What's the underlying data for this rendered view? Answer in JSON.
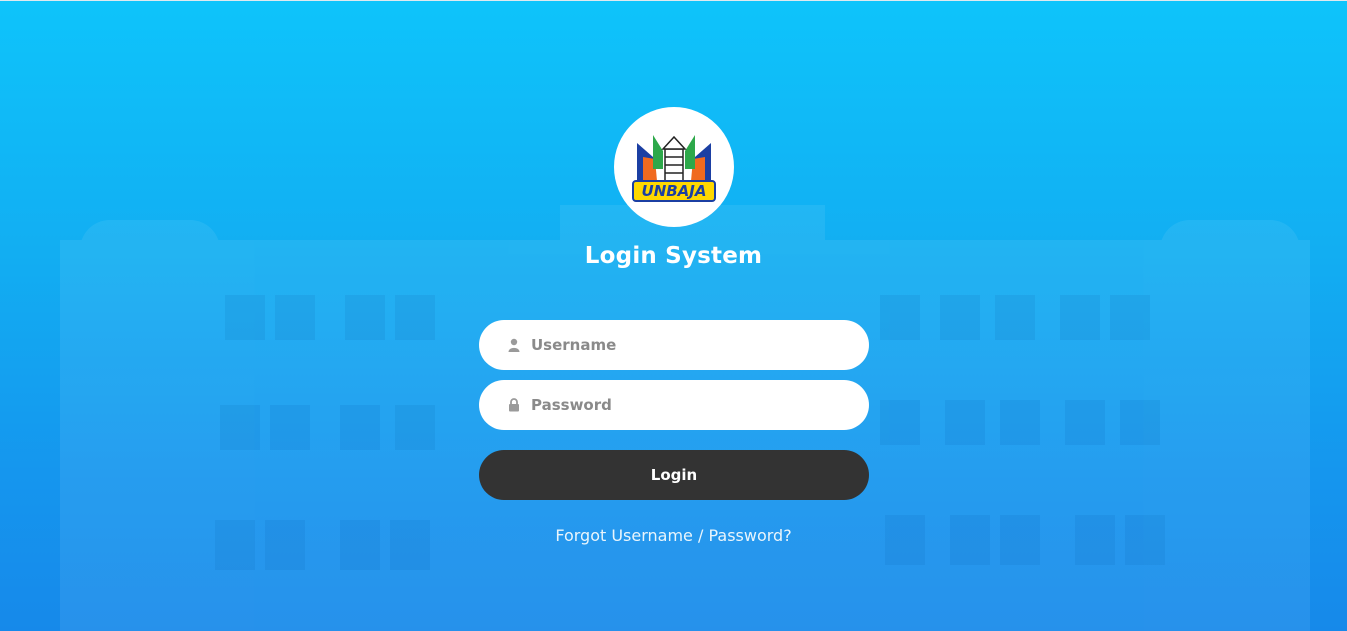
{
  "background_color": "#12aef2",
  "logo": {
    "text": "UNBAJA",
    "icon": "unbaja-logo"
  },
  "title": "Login System",
  "form": {
    "username_placeholder": "Username",
    "username_icon": "user-icon",
    "password_placeholder": "Password",
    "password_icon": "lock-icon",
    "login_label": "Login",
    "button_color": "#333333"
  },
  "forgot_link": "Forgot Username / Password?"
}
